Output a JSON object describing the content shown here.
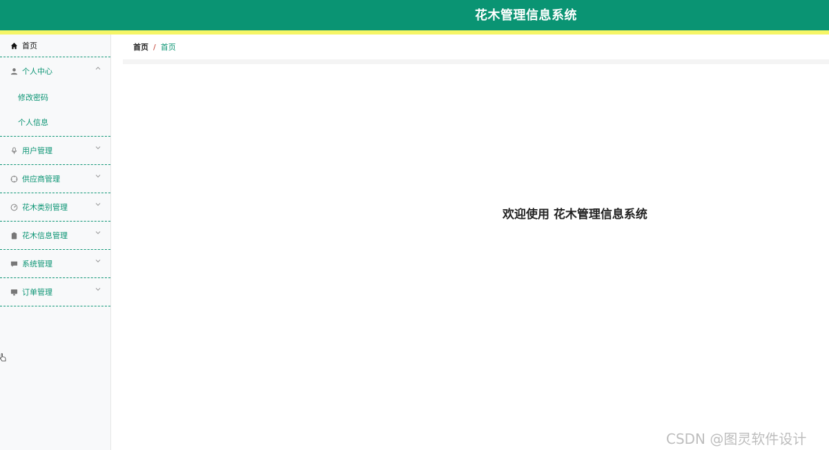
{
  "header": {
    "title": "花木管理信息系统"
  },
  "sidebar": {
    "home": {
      "label": "首页",
      "icon": "home-icon"
    },
    "items": [
      {
        "label": "个人中心",
        "icon": "user-icon",
        "expanded": true,
        "children": [
          {
            "label": "修改密码"
          },
          {
            "label": "个人信息"
          }
        ]
      },
      {
        "label": "用户管理",
        "icon": "microphone-icon",
        "expanded": false
      },
      {
        "label": "供应商管理",
        "icon": "compass-icon",
        "expanded": false
      },
      {
        "label": "花木类别管理",
        "icon": "gauge-icon",
        "expanded": false
      },
      {
        "label": "花木信息管理",
        "icon": "clipboard-icon",
        "expanded": false
      },
      {
        "label": "系统管理",
        "icon": "chat-icon",
        "expanded": false
      },
      {
        "label": "订单管理",
        "icon": "monitor-icon",
        "expanded": false
      }
    ]
  },
  "breadcrumb": {
    "home": "首页",
    "separator": "/",
    "current": "首页"
  },
  "main": {
    "welcome": "欢迎使用 花木管理信息系统"
  },
  "watermark": "CSDN @图灵软件设计",
  "colors": {
    "primary": "#0a9473",
    "accent_stripe": "#f5f566",
    "sidebar_bg": "#f8f9fa"
  }
}
